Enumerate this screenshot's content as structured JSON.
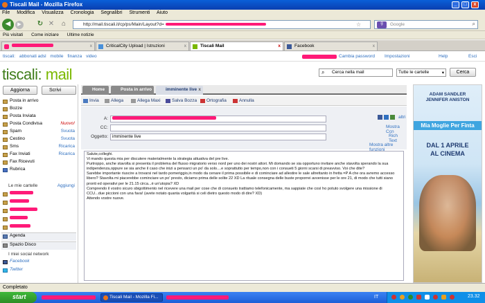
{
  "window": {
    "title": "Tiscali Mail - Mozilla Firefox"
  },
  "menu": [
    "File",
    "Modifica",
    "Visualizza",
    "Cronologia",
    "Segnalibri",
    "Strumenti",
    "Aiuto"
  ],
  "nav": {
    "url": "http://mail.tiscali.it/cp/ps/Main/Layout?d=",
    "search_placeholder": "Google"
  },
  "bookmarks": [
    "Più visitati",
    "Come iniziare",
    "Ultime notizie"
  ],
  "tabs": [
    {
      "label": "CriticalCity Upload | Istruzioni"
    },
    {
      "label": "Tiscali Mail"
    },
    {
      "label": "Facebook"
    }
  ],
  "tiscali_nav": {
    "items": [
      "tiscali:",
      "abbonati adsl",
      "mobile",
      "finanza",
      "video"
    ],
    "user": {
      "change_pwd": "Cambia password",
      "settings": "Impostazioni",
      "help": "Help",
      "exit": "Esci"
    }
  },
  "logo": {
    "left": "tiscali:",
    "right": " mail"
  },
  "mail_search": {
    "placeholder": "Cerca nella mail",
    "folder": "Tutte le cartelle",
    "button": "Cerca"
  },
  "sidebar": {
    "refresh": "Aggiorna",
    "compose": "Scrivi",
    "folders": [
      {
        "label": "Posta in arrivo",
        "extra": ""
      },
      {
        "label": "Bozze",
        "extra": ""
      },
      {
        "label": "Posta Inviata",
        "extra": ""
      },
      {
        "label": "Posta Condivisa",
        "extra": "Nuovo!"
      },
      {
        "label": "Spam",
        "extra": "Svuota"
      },
      {
        "label": "Cestino",
        "extra": "Svuota"
      },
      {
        "label": "Sms",
        "extra": "Ricarica"
      },
      {
        "label": "Fax Inviati",
        "extra": "Ricarica"
      },
      {
        "label": "Fax Ricevuti",
        "extra": ""
      },
      {
        "label": "Rubrica",
        "extra": ""
      }
    ],
    "my_folders": "Le mie cartelle",
    "add": "Aggiungi",
    "agenda": "Agenda",
    "disk": "Spazio Disco",
    "social_title": "I miei social network",
    "social": [
      "Facebook",
      "Twitter"
    ]
  },
  "main": {
    "tabs": [
      "Home",
      "Posta in arrivo",
      "imminente live"
    ],
    "toolbar": [
      "Invia",
      "Allega",
      "Allega Maxi",
      "Salva Bozza",
      "Ortografia",
      "Annulla"
    ],
    "fields": {
      "to_label": "A:",
      "cc_label": "CC:",
      "subject_label": "Oggetto:",
      "subject": "imminente live"
    },
    "links": {
      "altri": "altri",
      "show_cc": "Mostra Ccn",
      "rich_text": "Rich Text",
      "more": "Mostra altre funzioni"
    },
    "body": "Salute,colleghi.\nVi mando questa mia per discutere materialmente la strategia attuativa del pre live.\nPurtroppo, anche stavolta si presenta il problema del flusso migratorio verso nord per uno dei nostri attori. Mi domando se sia opportuno invitare anche stavolta sperando la sua indipendenza,oppure se sia anche il caso che inizi a pensarci un po' da solo....e soprattutto per tempo,non con i consueti 5 giorni scarsi di preavviso. Voi che dite?\nSarebbe importante riuscire a trovarsi nel tardo pomeriggio,in modo da cenare il prima possibile e di cominciare ad allestire le sale altrettanto in fretta =P A che ora avremo accesso libero? Stavolta mi piacerebbe cominciare un po' presto, diciamo prima delle solite 22 XD La rituale consegna delle buste proporrei avvenisse per le ore 21, di modo che tutti siano pronti ed operativi per le 21.15 circa...è un'utopia? XD\nComprendo il vostro sicuro sbigottimento nel ricevere una mail per cose che di consueto trattiamo telefonicamente, ma sappiate che così ho potuto svolgere una missione di CCU...due piccioni con una fava! (avete notato quanta volgarità si celi dietro questo modo di dire? XD)\nAttendo vostre nuove."
  },
  "ad": {
    "actors1": "ADAM SANDLER",
    "actors2": "JENNIFER ANISTON",
    "title": "Mia Moglie Per Finta",
    "date": "DAL 1 APRILE",
    "sub": "AL CINEMA"
  },
  "status": "Completato",
  "taskbar": {
    "start": "start",
    "task": "Tiscali Mail - Mozilla Fi...",
    "lang": "IT",
    "clock": "23.32"
  },
  "colors": {
    "accent_green": "#7ab800",
    "redaction": "#ff1a78"
  }
}
